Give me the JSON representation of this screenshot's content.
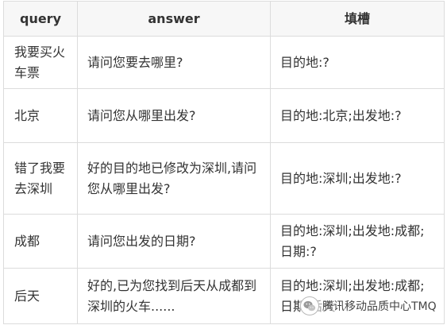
{
  "table": {
    "headers": [
      "query",
      "answer",
      "填槽"
    ],
    "rows": [
      {
        "query": "我要买火车票",
        "answer": "请问您要去哪里?",
        "slot": "目的地:?"
      },
      {
        "query": "北京",
        "answer": "请问您从哪里出发?",
        "slot": "目的地:北京;出发地:?"
      },
      {
        "query": "错了我要去深圳",
        "answer": "好的目的地已修改为深圳,请问您从哪里出发?",
        "slot": "目的地:深圳;出发地:?"
      },
      {
        "query": "成都",
        "answer": "请问您出发的日期?",
        "slot": "目的地:深圳;出发地:成都;日期:?"
      },
      {
        "query": "后天",
        "answer": "好的,已为您找到后天从成都到深圳的火车......",
        "slot": "目的地:深圳;出发地:成都;日期:后天"
      }
    ]
  },
  "watermark": {
    "text": "腾讯移动品质中心TMQ",
    "icon": "wechat-logo-icon"
  }
}
